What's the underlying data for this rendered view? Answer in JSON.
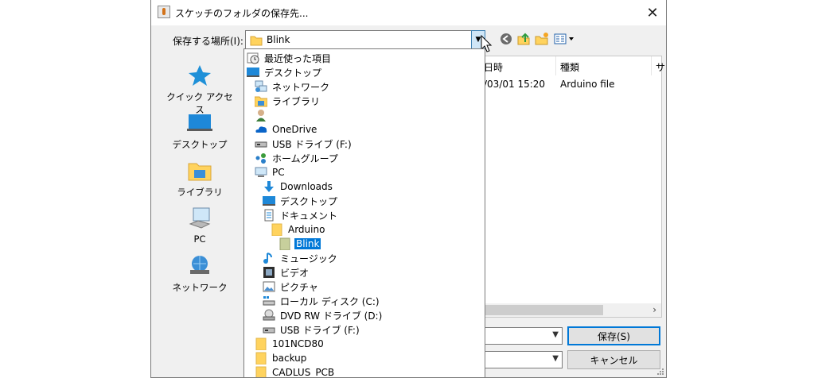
{
  "dialog": {
    "title": "スケッチのフォルダの保存先...",
    "close_glyph": "✕",
    "look_in_label": "保存する場所(I):",
    "look_in_value": "Blink"
  },
  "places": [
    {
      "label": "クイック アクセス",
      "icon": "star-icon"
    },
    {
      "label": "デスクトップ",
      "icon": "desktop-icon"
    },
    {
      "label": "ライブラリ",
      "icon": "library-icon"
    },
    {
      "label": "PC",
      "icon": "pc-icon"
    },
    {
      "label": "ネットワーク",
      "icon": "network-icon"
    }
  ],
  "filelist": {
    "columns": [
      "日時",
      "種類",
      "サ"
    ],
    "row": {
      "date": "/03/01 15:20",
      "type": "Arduino file"
    },
    "scroll_right_glyph": "›"
  },
  "buttons": {
    "save": "保存(S)",
    "cancel": "キャンセル"
  },
  "dropdown_items": [
    {
      "label": "最近使った項目",
      "icon": "recent-items-icon",
      "level": 0
    },
    {
      "label": "デスクトップ",
      "icon": "desktop-icon",
      "level": 0
    },
    {
      "label": "ネットワーク",
      "icon": "network-icon",
      "level": 1
    },
    {
      "label": "ライブラリ",
      "icon": "library-icon",
      "level": 1
    },
    {
      "label": "",
      "icon": "user-icon",
      "level": 1
    },
    {
      "label": "OneDrive",
      "icon": "onedrive-cloud-icon",
      "level": 1
    },
    {
      "label": "USB ドライブ (F:)",
      "icon": "usb-drive-icon",
      "level": 1
    },
    {
      "label": "ホームグループ",
      "icon": "homegroup-icon",
      "level": 1
    },
    {
      "label": "PC",
      "icon": "pc-icon",
      "level": 1
    },
    {
      "label": "Downloads",
      "icon": "downloads-arrow-icon",
      "level": 2
    },
    {
      "label": "デスクトップ",
      "icon": "desktop-icon",
      "level": 2
    },
    {
      "label": "ドキュメント",
      "icon": "document-icon",
      "level": 2
    },
    {
      "label": "Arduino",
      "icon": "folder-icon",
      "level": 3
    },
    {
      "label": "Blink",
      "icon": "folder-icon",
      "level": 4,
      "selected": true
    },
    {
      "label": "ミュージック",
      "icon": "music-note-icon",
      "level": 2
    },
    {
      "label": "ビデオ",
      "icon": "video-icon",
      "level": 2
    },
    {
      "label": "ピクチャ",
      "icon": "picture-icon",
      "level": 2
    },
    {
      "label": "ローカル ディスク (C:)",
      "icon": "local-disk-icon",
      "level": 2
    },
    {
      "label": "DVD RW ドライブ (D:)",
      "icon": "dvd-drive-icon",
      "level": 2
    },
    {
      "label": "USB ドライブ (F:)",
      "icon": "usb-drive-icon",
      "level": 2
    },
    {
      "label": "101NCD80",
      "icon": "folder-icon",
      "level": 1
    },
    {
      "label": "backup",
      "icon": "folder-icon",
      "level": 1
    },
    {
      "label": "CADLUS_PCB",
      "icon": "folder-icon",
      "level": 1
    }
  ],
  "colors": {
    "accent": "#0078d7",
    "folder": "#ffd35e",
    "dialog_bg": "#f0f0f0"
  }
}
